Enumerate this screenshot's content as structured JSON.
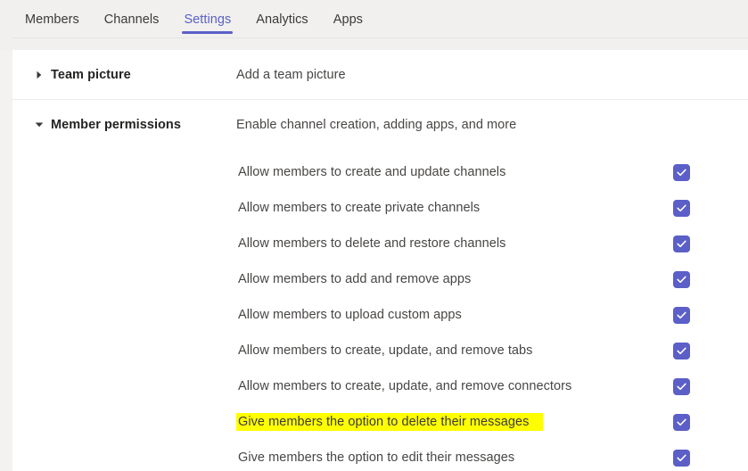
{
  "tabs": [
    {
      "label": "Members",
      "active": false
    },
    {
      "label": "Channels",
      "active": false
    },
    {
      "label": "Settings",
      "active": true
    },
    {
      "label": "Analytics",
      "active": false
    },
    {
      "label": "Apps",
      "active": false
    }
  ],
  "accent_color": "#5b5fc7",
  "highlight_color": "#ffff00",
  "sections": [
    {
      "title": "Team picture",
      "description": "Add a team picture",
      "expanded": false,
      "chevron_icon": "chevron-right-icon",
      "rows": []
    },
    {
      "title": "Member permissions",
      "description": "Enable channel creation, adding apps, and more",
      "expanded": true,
      "chevron_icon": "chevron-down-icon",
      "rows": [
        {
          "label": "Allow members to create and update channels",
          "checked": true,
          "highlighted": false
        },
        {
          "label": "Allow members to create private channels",
          "checked": true,
          "highlighted": false
        },
        {
          "label": "Allow members to delete and restore channels",
          "checked": true,
          "highlighted": false
        },
        {
          "label": "Allow members to add and remove apps",
          "checked": true,
          "highlighted": false
        },
        {
          "label": "Allow members to upload custom apps",
          "checked": true,
          "highlighted": false
        },
        {
          "label": "Allow members to create, update, and remove tabs",
          "checked": true,
          "highlighted": false
        },
        {
          "label": "Allow members to create, update, and remove connectors",
          "checked": true,
          "highlighted": false
        },
        {
          "label": "Give members the option to delete their messages",
          "checked": true,
          "highlighted": true
        },
        {
          "label": "Give members the option to edit their messages",
          "checked": true,
          "highlighted": false
        }
      ]
    }
  ]
}
